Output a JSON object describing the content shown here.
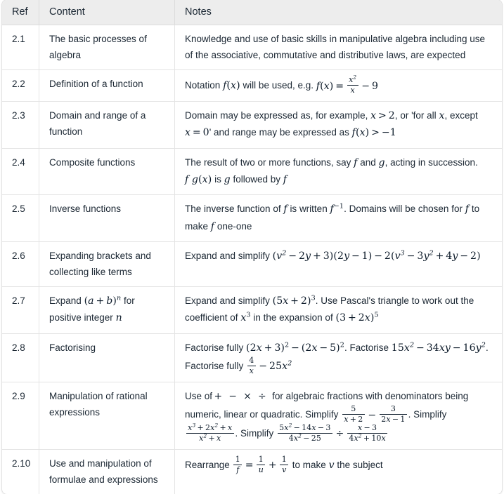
{
  "table": {
    "name": "specification-content-table",
    "headers": [
      "Ref",
      "Content",
      "Notes"
    ],
    "rows": [
      {
        "ref": "2.1",
        "content": "The basic processes of algebra",
        "notes_text": "Knowledge and use of basic skills in manipulative algebra including use of the associative, commutative and distributive laws, are expected"
      },
      {
        "ref": "2.2",
        "content": "Definition of a function",
        "notes_text": "Notation f(x) will be used, e.g. f(x) = x²/x − 9",
        "notes_parts": {
          "lead": "Notation",
          "math1": "f(x)",
          "mid": "will be used, e.g.",
          "math2": "f(x) = x²/x − 9"
        }
      },
      {
        "ref": "2.3",
        "content": "Domain and range of a function",
        "notes_text": "Domain may be expressed as, for example, x > 2, or 'for all x, except x = 0' and range may be expressed as f(x) > −1",
        "notes_parts": {
          "lead": "Domain may be expressed as, for example,",
          "math1": "x > 2",
          "mid1": ", or 'for all",
          "math2": "x",
          "mid2": ", except",
          "math3": "x = 0",
          "mid3": "' and range may be expressed as",
          "math4": "f(x) > −1"
        }
      },
      {
        "ref": "2.4",
        "content": "Composite functions",
        "notes_text": "The result of two or more functions, say f and g, acting in succession. fg(x) is g followed by f",
        "notes_parts": {
          "lead": "The result of two or more functions, say",
          "math1": "f",
          "mid1": "and",
          "math2": "g",
          "mid2": ", acting in succession.",
          "math3": "fg(x)",
          "mid3": "is",
          "math4": "g",
          "mid4": "followed by",
          "math5": "f"
        }
      },
      {
        "ref": "2.5",
        "content": "Inverse functions",
        "notes_text": "The inverse function of f is written f⁻¹. Domains will be chosen for f to make f one-one",
        "notes_parts": {
          "lead": "The inverse function of",
          "math1": "f",
          "mid1": "is written",
          "math2": "f⁻¹",
          "mid2": ". Domains will be chosen for",
          "math3": "f",
          "mid3": "to make",
          "math4": "f",
          "mid4": "one-one"
        }
      },
      {
        "ref": "2.6",
        "content": "Expanding brackets and collecting like terms",
        "notes_text": "Expand and simplify (v² − 2y + 3)(2y − 1) − 2(v³ − 3y² + 4y − 2)",
        "notes_parts": {
          "lead": "Expand and simplify",
          "math1": "(v² − 2y + 3)(2y − 1) − 2(v³ − 3y² + 4y − 2)"
        }
      },
      {
        "ref": "2.7",
        "content": "Expand (a + b)ⁿ for positive integer n",
        "content_parts": {
          "lead": "Expand",
          "math1": "(a + b)ⁿ",
          "mid1": "for positive integer",
          "math2": "n"
        },
        "notes_text": "Expand and simplify (5x + 2)³. Use Pascal's triangle to work out the coefficient of x³ in the expansion of (3 + 2x)⁵",
        "notes_parts": {
          "lead": "Expand and simplify",
          "math1": "(5x + 2)³",
          "mid1": ". Use Pascal's triangle to work out the coefficient of",
          "math2": "x³",
          "mid2": "in the expansion of",
          "math3": "(3 + 2x)⁵"
        }
      },
      {
        "ref": "2.8",
        "content": "Factorising",
        "notes_text": "Factorise fully (2x + 3)² − (2x − 5)². Factorise 15x² − 34xy − 16y². Factorise fully 4/x − 25x²",
        "notes_parts": {
          "lead": "Factorise fully",
          "math1": "(2x + 3)² − (2x − 5)²",
          "mid1": ". Factorise",
          "math2": "15x² − 34xy − 16y²",
          "mid2": ". Factorise fully",
          "math3": "4/x − 25x²"
        }
      },
      {
        "ref": "2.9",
        "content": "Manipulation of rational expressions",
        "notes_text": "Use of + − × ÷ for algebraic fractions with denominators being numeric, linear or quadratic. Simplify 5/(x+2) − 3/(2x−1). Simplify (x³+2x²+x)/(x²+x). Simplify (5x²−14x−3)/(4x²−25) ÷ (x−3)/(4x²+10x)",
        "notes_parts": {
          "lead": "Use of",
          "ops": "+ − × ÷",
          "mid1": "for algebraic fractions with denominators being numeric, linear or quadratic. Simplify",
          "math1": "5/(x+2) − 3/(2x−1)",
          "mid2": ". Simplify",
          "math2": "(x³+2x²+x)/(x²+x)",
          "mid3": ". Simplify",
          "math3": "(5x²−14x−3)/(4x²−25) ÷ (x−3)/(4x²+10x)"
        }
      },
      {
        "ref": "2.10",
        "content": "Use and manipulation of formulae and expressions",
        "notes_text": "Rearrange 1/f = 1/u + 1/v to make v the subject",
        "notes_parts": {
          "lead": "Rearrange",
          "math1": "1/f = 1/u + 1/v",
          "mid1": "to make",
          "math2": "v",
          "mid2": "the subject"
        }
      }
    ]
  },
  "colors": {
    "header_bg": "#ededed",
    "border": "#e4e4e4",
    "text": "#1b2733",
    "math_text": "#0d1b2a",
    "page_bg": "#ffffff"
  }
}
